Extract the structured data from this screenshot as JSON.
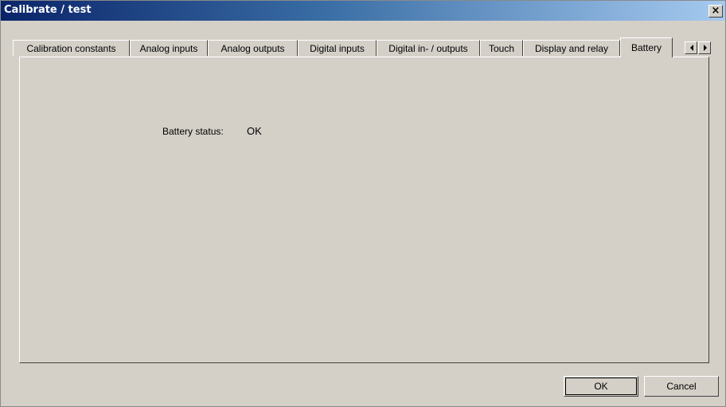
{
  "window": {
    "title": "Calibrate / test",
    "close_glyph": "×"
  },
  "tabs": [
    {
      "label": "Calibration constants",
      "active": false
    },
    {
      "label": "Analog inputs",
      "active": false
    },
    {
      "label": "Analog outputs",
      "active": false
    },
    {
      "label": "Digital inputs",
      "active": false
    },
    {
      "label": "Digital in- / outputs",
      "active": false
    },
    {
      "label": "Touch",
      "active": false
    },
    {
      "label": "Display and relay",
      "active": false
    },
    {
      "label": "Battery",
      "active": true
    }
  ],
  "tab_scroll": {
    "left_icon": "arrow-left-icon",
    "right_icon": "arrow-right-icon"
  },
  "battery_panel": {
    "status_label": "Battery status:",
    "status_value": "OK"
  },
  "buttons": {
    "ok_label": "OK",
    "cancel_label": "Cancel"
  },
  "colors": {
    "titlebar_start": "#0a246a",
    "titlebar_end": "#a6caf0",
    "dialog_face": "#d4d0c8"
  }
}
